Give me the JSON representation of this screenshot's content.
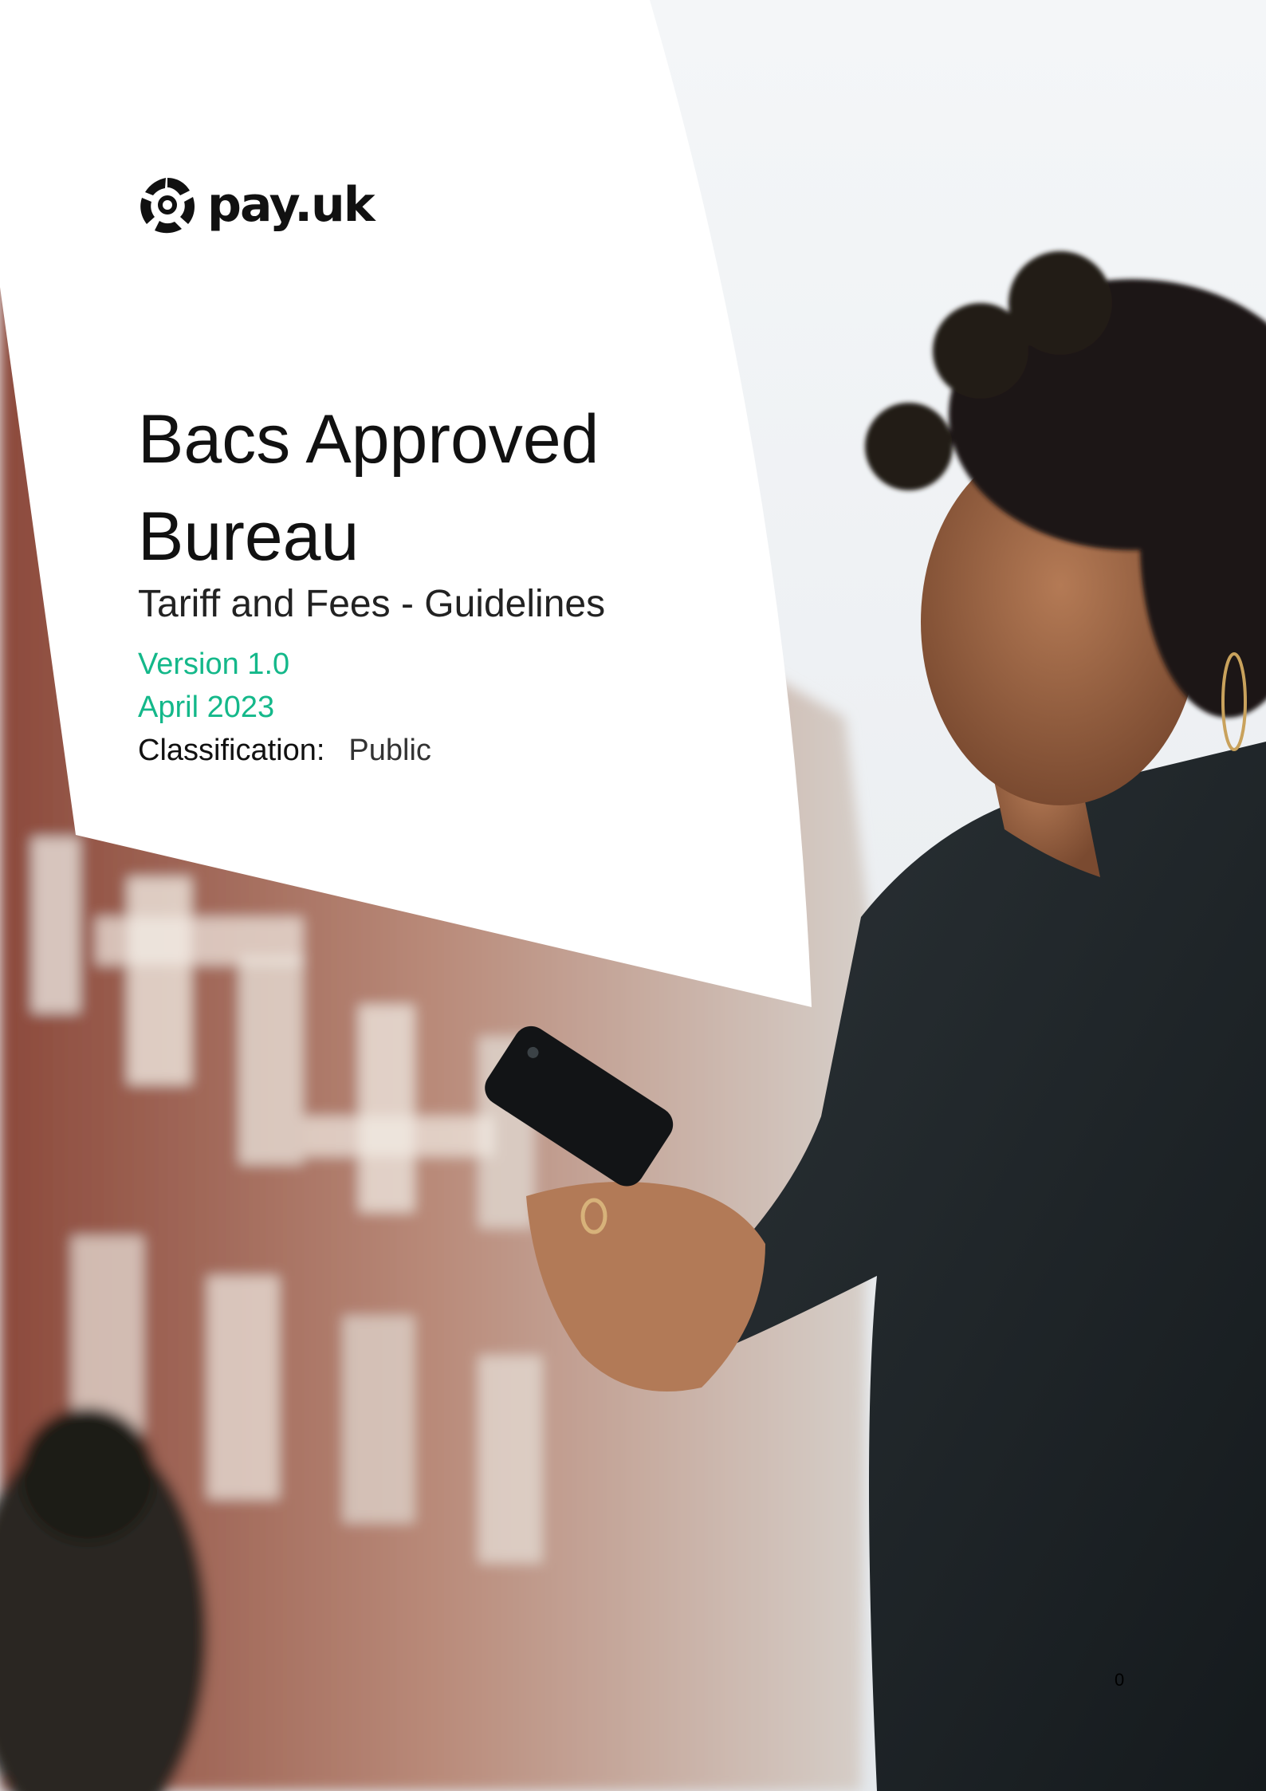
{
  "logo": {
    "text": "pay.uk",
    "icon": "payuk-logo-icon"
  },
  "document": {
    "title_line1": "Bacs Approved",
    "title_line2": "Bureau",
    "subtitle": "Tariff and Fees - Guidelines",
    "version": "Version 1.0",
    "date": "April 2023",
    "classification_label": "Classification:",
    "classification_value": "Public"
  },
  "page_number": "0",
  "colors": {
    "accent": "#14b88a",
    "text": "#111111",
    "panel": "#ffffff"
  }
}
